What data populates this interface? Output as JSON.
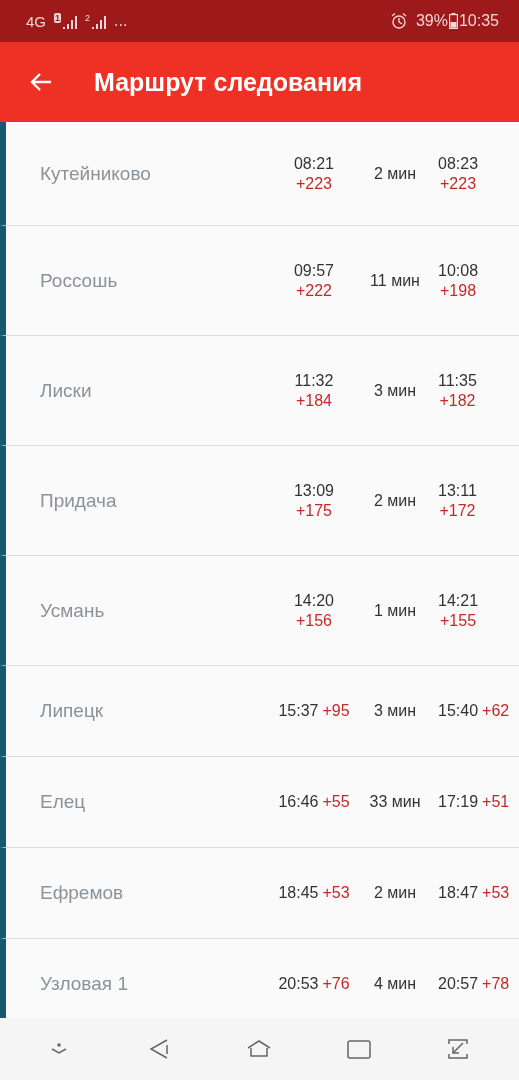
{
  "status_bar": {
    "network": "4G",
    "sim_1": "1",
    "sim_2": "2",
    "more": "...",
    "battery": "39%",
    "time": "10:35"
  },
  "app_bar": {
    "title": "Маршрут следования"
  },
  "stops": [
    {
      "kind": "stacked",
      "name": "Кутейниково",
      "arrival": "08:21",
      "arrival_delay": "+223",
      "stop": "2 мин",
      "departure": "08:23",
      "departure_delay": "+223"
    },
    {
      "kind": "stacked",
      "name": "Россошь",
      "arrival": "09:57",
      "arrival_delay": "+222",
      "stop": "11 мин",
      "departure": "10:08",
      "departure_delay": "+198"
    },
    {
      "kind": "stacked",
      "name": "Лиски",
      "arrival": "11:32",
      "arrival_delay": "+184",
      "stop": "3 мин",
      "departure": "11:35",
      "departure_delay": "+182"
    },
    {
      "kind": "stacked",
      "name": "Придача",
      "arrival": "13:09",
      "arrival_delay": "+175",
      "stop": "2 мин",
      "departure": "13:11",
      "departure_delay": "+172"
    },
    {
      "kind": "stacked",
      "name": "Усмань",
      "arrival": "14:20",
      "arrival_delay": "+156",
      "stop": "1 мин",
      "departure": "14:21",
      "departure_delay": "+155"
    },
    {
      "kind": "inline",
      "name": "Липецк",
      "arrival": "15:37",
      "arrival_delay": "+95",
      "stop": "3 мин",
      "departure": "15:40",
      "departure_delay": "+62"
    },
    {
      "kind": "inline",
      "name": "Елец",
      "arrival": "16:46",
      "arrival_delay": "+55",
      "stop": "33 мин",
      "departure": "17:19",
      "departure_delay": "+51"
    },
    {
      "kind": "inline",
      "name": "Ефремов",
      "arrival": "18:45",
      "arrival_delay": "+53",
      "stop": "2 мин",
      "departure": "18:47",
      "departure_delay": "+53"
    },
    {
      "kind": "inline",
      "name": "Узловая 1",
      "arrival": "20:53",
      "arrival_delay": "+76",
      "stop": "4 мин",
      "departure": "20:57",
      "departure_delay": "+78"
    }
  ]
}
